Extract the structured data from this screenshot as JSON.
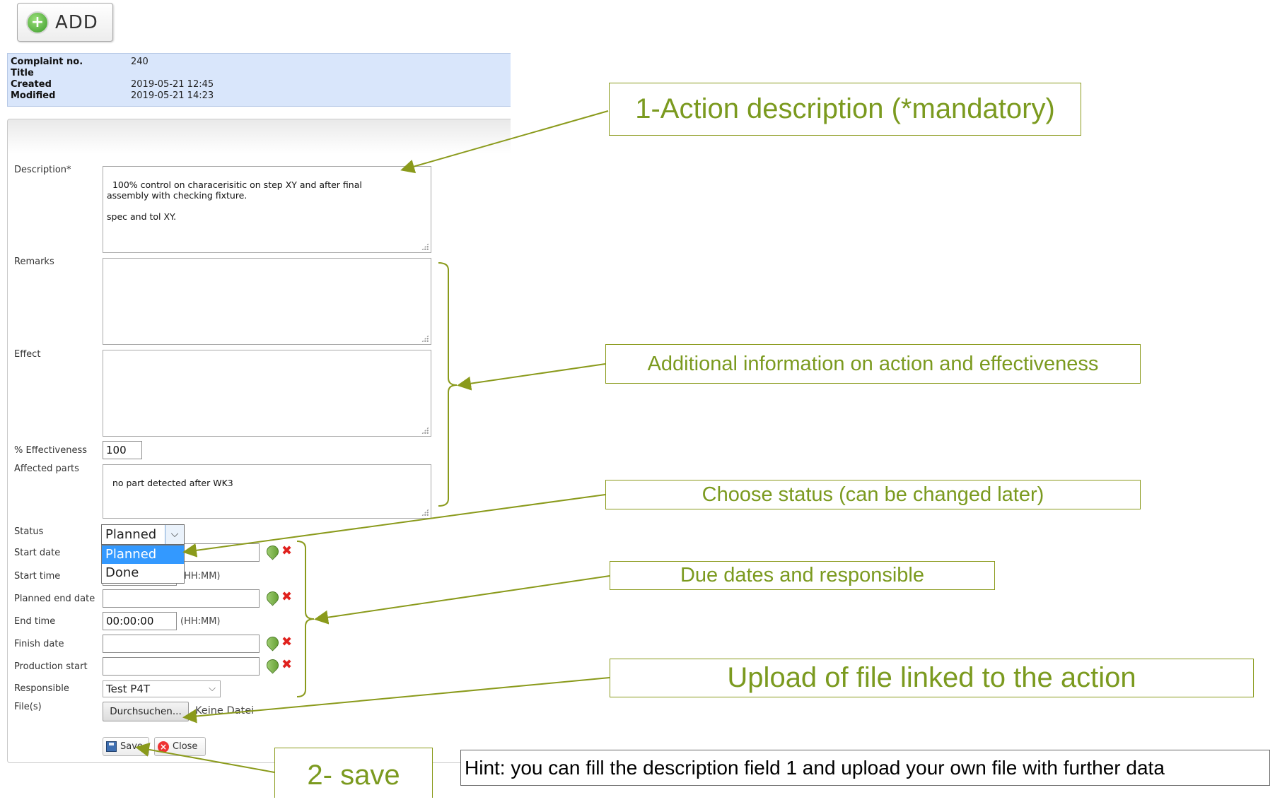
{
  "toolbar": {
    "add_label": "ADD"
  },
  "header": {
    "rows": [
      {
        "label": "Complaint no.",
        "value": "240"
      },
      {
        "label": "Title",
        "value": ""
      },
      {
        "label": "Created",
        "value": "2019-05-21 12:45"
      },
      {
        "label": "Modified",
        "value": "2019-05-21 14:23"
      }
    ]
  },
  "form": {
    "description": {
      "label": "Description*",
      "value": "100% control on characerisitic on step XY and after final\nassembly with checking fixture.\n\nspec and tol XY."
    },
    "remarks": {
      "label": "Remarks",
      "value": ""
    },
    "effect": {
      "label": "Effect",
      "value": ""
    },
    "effectiveness": {
      "label": "% Effectiveness",
      "value": "100"
    },
    "affected_parts": {
      "label": "Affected parts",
      "value": "no part detected after WK3"
    },
    "status": {
      "label": "Status",
      "selected": "Planned",
      "options": [
        "Planned",
        "Done"
      ]
    },
    "start_date": {
      "label": "Start date",
      "value": ""
    },
    "start_time": {
      "label": "Start time",
      "value": "",
      "format": "(HH:MM)"
    },
    "planned_end_date": {
      "label": "Planned end date",
      "value": ""
    },
    "end_time": {
      "label": "End time",
      "value": "00:00:00",
      "format": "(HH:MM)"
    },
    "finish_date": {
      "label": "Finish date",
      "value": ""
    },
    "production_start": {
      "label": "Production start",
      "value": ""
    },
    "responsible": {
      "label": "Responsible",
      "value": "Test P4T"
    },
    "files": {
      "label": "File(s)",
      "button": "Durchsuchen...",
      "status": "Keine Datei"
    },
    "save_label": "Save",
    "close_label": "Close"
  },
  "callouts": {
    "action_description": "1-Action description (*mandatory)",
    "additional_info": "Additional information on action and effectiveness",
    "choose_status": "Choose status (can be changed later)",
    "due_dates": "Due dates and responsible",
    "upload": "Upload of file linked to the action",
    "save": "2- save",
    "hint": "Hint: you can fill the description field 1  and upload your own file with further data"
  },
  "colors": {
    "callout": "#7b9a1f",
    "header_bg": "#d9e6fb",
    "select_highlight": "#3399ff"
  }
}
